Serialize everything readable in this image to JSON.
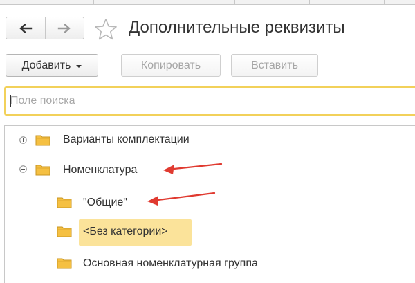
{
  "window": {
    "title": "Дополнительные реквизиты"
  },
  "nav": {
    "back_icon": "arrow-left-icon",
    "forward_icon": "arrow-right-icon",
    "favorite_icon": "star-outline-icon"
  },
  "toolbar": {
    "add_label": "Добавить",
    "copy_label": "Копировать",
    "paste_label": "Вставить"
  },
  "search": {
    "placeholder": "Поле поиска",
    "value": ""
  },
  "tree": {
    "items": [
      {
        "label": "Варианты комплектации",
        "level": 0,
        "expander": "plus",
        "selected": false
      },
      {
        "label": "Номенклатура",
        "level": 0,
        "expander": "minus",
        "selected": false
      },
      {
        "label": "\"Общие\"",
        "level": 1,
        "expander": "none",
        "selected": false
      },
      {
        "label": "<Без категории>",
        "level": 1,
        "expander": "none",
        "selected": true
      },
      {
        "label": "Основная номенклатурная группа",
        "level": 1,
        "expander": "none",
        "selected": false
      }
    ]
  },
  "colors": {
    "accent_search_border": "#f2d15a",
    "selection": "#fbe39a",
    "folder": "#f5c042",
    "annotation_arrow": "#e03a30"
  }
}
